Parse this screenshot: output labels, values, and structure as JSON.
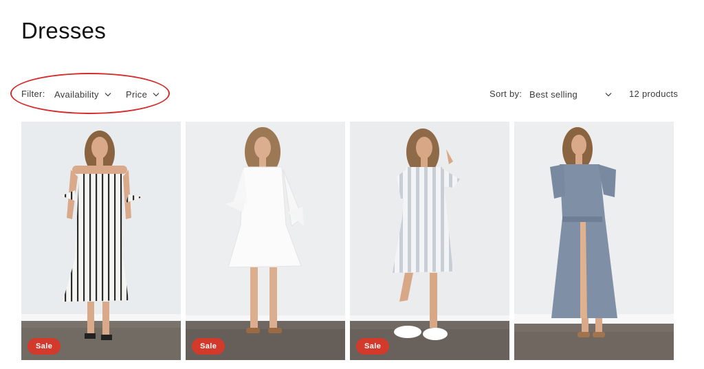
{
  "collection": {
    "title": "Dresses"
  },
  "filter": {
    "label": "Filter:",
    "facets": [
      {
        "label": "Availability",
        "icon": "chevron-down-icon"
      },
      {
        "label": "Price",
        "icon": "chevron-down-icon"
      }
    ],
    "annotation_color": "#d62c2c"
  },
  "sort": {
    "label": "Sort by:",
    "selected": "Best selling",
    "icon": "chevron-down-icon"
  },
  "product_count": "12 products",
  "products": [
    {
      "dress": "white dress with black vertical stripes",
      "badge": "Sale"
    },
    {
      "dress": "white ruffled mini dress",
      "badge": "Sale"
    },
    {
      "dress": "white and grey striped button dress",
      "badge": "Sale"
    },
    {
      "dress": "blue chambray wrap midi dress"
    }
  ],
  "colors": {
    "sale_badge": "#d33a2c",
    "text": "#121212"
  }
}
